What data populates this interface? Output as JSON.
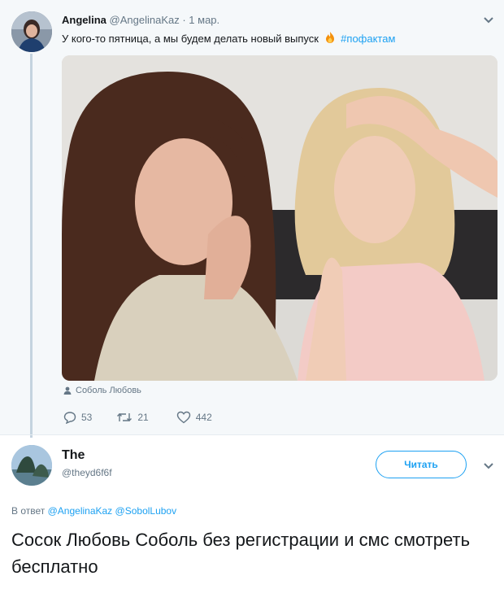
{
  "tweet": {
    "author_name": "Angelina",
    "author_handle": "@AngelinaKaz",
    "separator": " · ",
    "date": "1 мар.",
    "text": "У кого-то пятница, а мы будем делать новый выпуск",
    "hashtag": "#пофактам",
    "photo_tag": "Соболь Любовь",
    "replies": "53",
    "retweets": "21",
    "likes": "442"
  },
  "reply": {
    "author_name": "The",
    "author_handle": "@theyd6f6f",
    "follow_label": "Читать",
    "reply_prefix": "В ответ",
    "mentions": [
      "@AngelinaKaz",
      "@SobolLubov"
    ],
    "text": "Сосок Любовь Соболь без регистрации и смс смотреть бесплатно"
  },
  "colors": {
    "accent": "#1da1f2",
    "secondary_text": "#657786",
    "primary_text": "#14171a",
    "thread_line": "#c4d3df",
    "top_tweet_background": "#f5f8fa"
  },
  "icons": {
    "reply": "reply-icon",
    "retweet": "retweet-icon",
    "like": "heart-icon",
    "menu": "chevron-down-icon",
    "tag": "person-icon",
    "emoji": "fire-emoji"
  }
}
